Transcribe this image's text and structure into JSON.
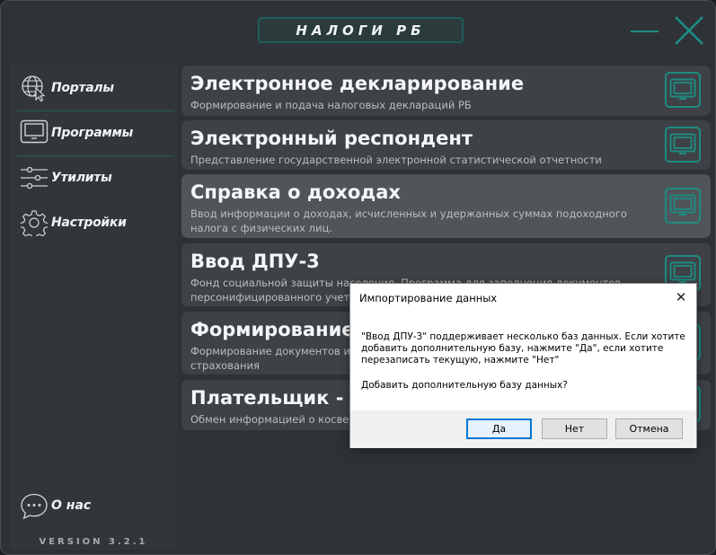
{
  "app": {
    "title": "НАЛОГИ РБ"
  },
  "sidebar": {
    "items": [
      {
        "label": "Порталы",
        "icon": "globe-cursor-icon"
      },
      {
        "label": "Программы",
        "icon": "monitor-icon"
      },
      {
        "label": "Утилиты",
        "icon": "sliders-icon"
      },
      {
        "label": "Настройки",
        "icon": "gear-icon"
      }
    ],
    "about_label": "О нас",
    "version": "VERSION 3.2.1"
  },
  "programs": [
    {
      "title": "Электронное декларирование",
      "desc": "Формирование и подача налоговых деклараций РБ"
    },
    {
      "title": "Электронный респондент",
      "desc": "Представление государственной электронной статистической отчетности"
    },
    {
      "title": "Справка о доходах",
      "desc": "Ввод информации о доходах, исчисленных и удержанных суммах подоходного налога с физических лиц."
    },
    {
      "title": "Ввод ДПУ-3",
      "desc": "Фонд социальной защиты населения. Программа для заполнения документов персонифицированного учета."
    },
    {
      "title": "Формирование Г",
      "desc": "Формирование документов инди",
      "desc2": "страхования"
    },
    {
      "title": "Плательщик - ТС",
      "desc": "Обмен информацией о косвенн"
    }
  ],
  "dialog": {
    "title": "Импортирование данных",
    "close": "✕",
    "message": "\"Ввод ДПУ-3\" поддерживает несколько баз данных. Если хотите добавить дополнительную базу, нажмите \"Да\", если хотите перезаписать текущую, нажмите \"Нет\"",
    "question": "Добавить дополнительную базу данных?",
    "buttons": {
      "yes": "Да",
      "no": "Нет",
      "cancel": "Отмена"
    }
  },
  "colors": {
    "accent": "#1f8b80",
    "background": "#2e3237",
    "card": "#3e4247",
    "card_active": "#50555a"
  }
}
